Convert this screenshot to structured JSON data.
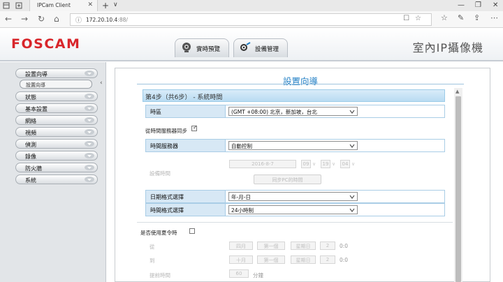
{
  "browser": {
    "tab_title": "IPCam Client",
    "tab_close": "✕",
    "new_tab": "+",
    "tab_menu": "∨",
    "url_host": "172.20.10.4",
    "url_path": ":88/",
    "win_min": "—",
    "win_max": "❐",
    "win_close": "✕"
  },
  "header": {
    "logo": "FOSCAM",
    "tab_live": "實時預覽",
    "tab_settings": "設備管理",
    "product": "室內IP攝像機"
  },
  "sidebar": {
    "items": [
      {
        "label": "設置向導"
      },
      {
        "label": "狀態"
      },
      {
        "label": "基本設置"
      },
      {
        "label": "網絡"
      },
      {
        "label": "視頻"
      },
      {
        "label": "偵測"
      },
      {
        "label": "錄像"
      },
      {
        "label": "防火牆"
      },
      {
        "label": "系統"
      }
    ],
    "sub_active": "設置向導"
  },
  "main": {
    "title": "設置向導",
    "step": "第4步（共6步） - 系統時間",
    "timezone_label": "時區",
    "timezone_value": "(GMT +08:00) 北京，新加坡，台北",
    "sync_label": "從時間服務器同步",
    "time_server_label": "時間服務器",
    "time_server_value": "自動控制",
    "device_time_label": "設備時間",
    "device_date": "2016-8-7",
    "device_hour": "09",
    "device_min": "19",
    "device_sec": "04",
    "sync_pc_button": "同步PC的時間",
    "date_format_label": "日期格式選擇",
    "date_format_value": "年-月-日",
    "time_format_label": "時間格式選擇",
    "time_format_value": "24小時制",
    "dst_label": "是否使用夏令時",
    "from_label": "從",
    "to_label": "到",
    "advance_label": "提前時間",
    "from_month": "四月",
    "from_week": "第一個",
    "from_day": "星期日",
    "from_hour": "2",
    "from_suffix": "0:0",
    "to_month": "十月",
    "to_week": "第一個",
    "to_day": "星期日",
    "to_hour": "2",
    "to_suffix": "0:0",
    "advance_value": "60",
    "advance_unit": "分鐘"
  },
  "colors": {
    "accent": "#1f7ec4",
    "logo": "#d8262b",
    "row_label_bg": "#d7e8f5"
  }
}
